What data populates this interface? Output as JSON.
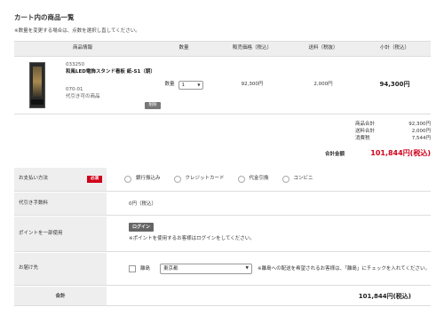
{
  "section_title": "カート内の商品一覧",
  "note": "※数量を変更する場合は、点数を選択し直してください。",
  "table": {
    "headers": {
      "info": "商品情報",
      "qty": "数量",
      "price": "販売価格（税込）",
      "shipping": "送料（税抜）",
      "subtotal": "小計（税込）"
    },
    "item": {
      "code": "033250",
      "name": "和風LED電飾スタンド看板 紙-S1（朝）",
      "variant_code": "070-01",
      "option": "代引き可の商品",
      "delete_label": "削除",
      "qty_label": "数量",
      "qty_value": "1",
      "price": "92,300円",
      "shipping": "2,000円",
      "subtotal": "94,300円"
    }
  },
  "summary": {
    "rows": [
      {
        "label": "商品合計",
        "value": "92,300円"
      },
      {
        "label": "送料合計",
        "value": "2,000円"
      },
      {
        "label": "消費税",
        "value": "7,544円"
      }
    ],
    "grand_label": "合計金額",
    "grand_value": "101,844円(税込)"
  },
  "payment": {
    "label": "お支払い方法",
    "required": "必須",
    "options": [
      "銀行振込み",
      "クレジットカード",
      "代金引換",
      "コンビニ"
    ]
  },
  "cod_fee": {
    "label": "代引き手数料",
    "value": "0円（税込）"
  },
  "points": {
    "label": "ポイントを一部使用",
    "login_label": "ログイン",
    "note": "※ポイントを使用するお客様はログインをしてください。"
  },
  "delivery": {
    "label": "お届け先",
    "island_label": "離島",
    "prefecture": "東京都",
    "note": "※離島への配送を希望されるお客様は、「離島」にチェックを入れてください。"
  },
  "total": {
    "label": "合計",
    "value": "101,844円(税込)"
  },
  "colors": {
    "accent_red": "#d0021b",
    "header_bg": "#eeeeee",
    "button_gray": "#666666"
  }
}
